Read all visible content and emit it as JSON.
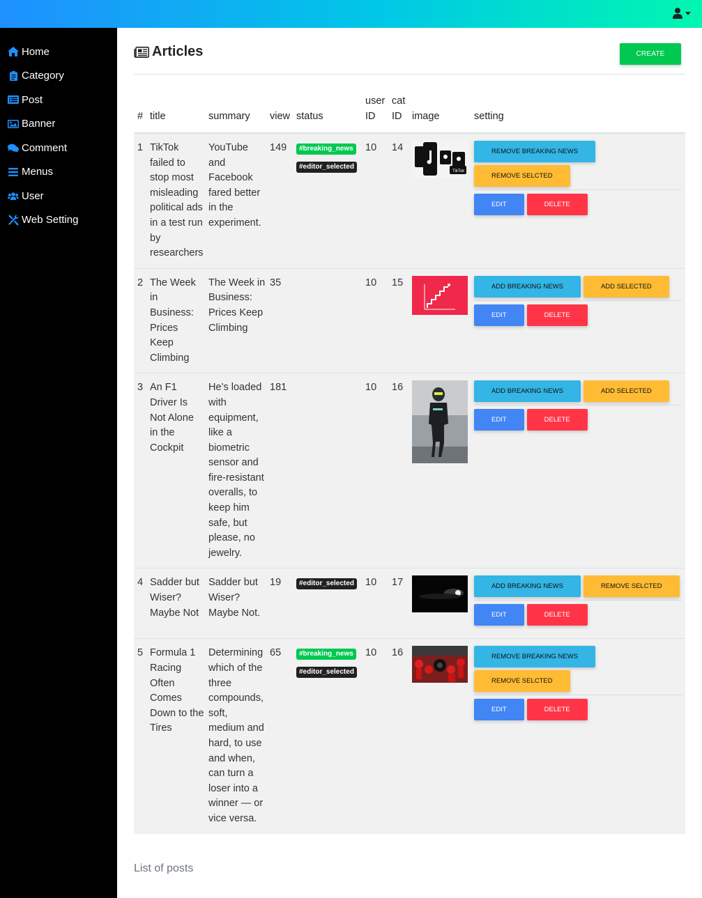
{
  "colors": {
    "accent": "#00c851",
    "info": "#33b5e5",
    "warning": "#ffbb33",
    "primary": "#4285f4",
    "danger": "#ff3547"
  },
  "topbar": {
    "user_icon": "user-icon"
  },
  "sidebar": {
    "items": [
      {
        "label": "Home",
        "icon": "home-icon"
      },
      {
        "label": "Category",
        "icon": "clipboard-icon"
      },
      {
        "label": "Post",
        "icon": "list-alt-icon"
      },
      {
        "label": "Banner",
        "icon": "image-icon"
      },
      {
        "label": "Comment",
        "icon": "comments-icon"
      },
      {
        "label": "Menus",
        "icon": "bars-icon"
      },
      {
        "label": "User",
        "icon": "users-icon"
      },
      {
        "label": "Web Setting",
        "icon": "tools-icon"
      }
    ]
  },
  "page": {
    "title": "Articles",
    "create_label": "CREATE"
  },
  "table": {
    "headers": {
      "num": "#",
      "title": "title",
      "summary": "summary",
      "view": "view",
      "status": "status",
      "user_id": "user ID",
      "cat_id": "cat ID",
      "image": "image",
      "setting": "setting"
    },
    "rows": [
      {
        "num": "1",
        "title": "TikTok failed to stop most misleading political ads in a test run by researchers",
        "summary": "YouTube and Facebook fared better in the experiment.",
        "view": "149",
        "badges": [
          "#breaking_news",
          "#editor_selected"
        ],
        "user_id": "10",
        "cat_id": "14",
        "btn_breaking": "REMOVE BREAKING NEWS",
        "btn_selected": "REMOVE SELCTED",
        "edit": "EDIT",
        "delete": "DELETE"
      },
      {
        "num": "2",
        "title": "The Week in Business: Prices Keep Climbing",
        "summary": "The Week in Business: Prices Keep Climbing",
        "view": "35",
        "badges": [],
        "user_id": "10",
        "cat_id": "15",
        "btn_breaking": "ADD BREAKING NEWS",
        "btn_selected": "ADD SELECTED",
        "edit": "EDIT",
        "delete": "DELETE"
      },
      {
        "num": "3",
        "title": "An F1 Driver Is Not Alone in the Cockpit",
        "summary": "He’s loaded with equipment, like a biometric sensor and fire-resistant overalls, to keep him safe, but please, no jewelry.",
        "view": "181",
        "badges": [],
        "user_id": "10",
        "cat_id": "16",
        "btn_breaking": "ADD BREAKING NEWS",
        "btn_selected": "ADD SELECTED",
        "edit": "EDIT",
        "delete": "DELETE"
      },
      {
        "num": "4",
        "title": "Sadder but Wiser? Maybe Not",
        "summary": "Sadder but Wiser? Maybe Not.",
        "view": "19",
        "badges": [
          "#editor_selected"
        ],
        "user_id": "10",
        "cat_id": "17",
        "btn_breaking": "ADD BREAKING NEWS",
        "btn_selected": "REMOVE SELCTED",
        "edit": "EDIT",
        "delete": "DELETE"
      },
      {
        "num": "5",
        "title": "Formula 1 Racing Often Comes Down to the Tires",
        "summary": "Determining which of the three compounds, soft, medium and hard, to use and when, can turn a loser into a winner — or vice versa.",
        "view": "65",
        "badges": [
          "#breaking_news",
          "#editor_selected"
        ],
        "user_id": "10",
        "cat_id": "16",
        "btn_breaking": "REMOVE BREAKING NEWS",
        "btn_selected": "REMOVE SELCTED",
        "edit": "EDIT",
        "delete": "DELETE"
      }
    ]
  },
  "caption": "List of posts"
}
